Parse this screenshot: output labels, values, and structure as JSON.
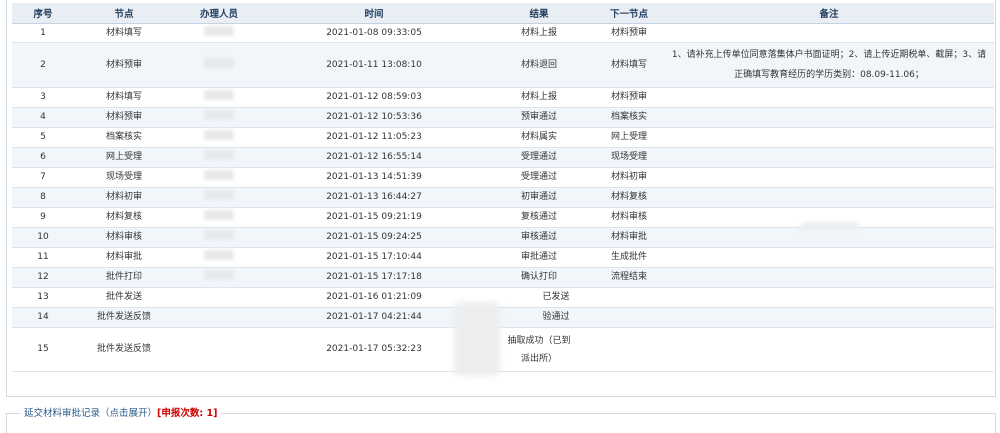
{
  "table": {
    "headers": [
      "序号",
      "节点",
      "办理人员",
      "时间",
      "结果",
      "下一节点",
      "备注"
    ],
    "rows": [
      {
        "no": "1",
        "node": "材料填写",
        "time": "2021-01-08 09:33:05",
        "result": "材料上报",
        "next": "材料预审",
        "remark": ""
      },
      {
        "no": "2",
        "node": "材料预审",
        "time": "2021-01-11 13:08:10",
        "result": "材料退回",
        "next": "材料填写",
        "remark": "1、请补充上传单位同意落集体户书面证明；2、请上传近期税单、截屏；3、请正确填写教育经历的学历类别：08.09-11.06；"
      },
      {
        "no": "3",
        "node": "材料填写",
        "time": "2021-01-12 08:59:03",
        "result": "材料上报",
        "next": "材料预审",
        "remark": ""
      },
      {
        "no": "4",
        "node": "材料预审",
        "time": "2021-01-12 10:53:36",
        "result": "预审通过",
        "next": "档案核实",
        "remark": ""
      },
      {
        "no": "5",
        "node": "档案核实",
        "time": "2021-01-12 11:05:23",
        "result": "材料属实",
        "next": "网上受理",
        "remark": ""
      },
      {
        "no": "6",
        "node": "网上受理",
        "time": "2021-01-12 16:55:14",
        "result": "受理通过",
        "next": "现场受理",
        "remark": ""
      },
      {
        "no": "7",
        "node": "现场受理",
        "time": "2021-01-13 14:51:39",
        "result": "受理通过",
        "next": "材料初审",
        "remark": ""
      },
      {
        "no": "8",
        "node": "材料初审",
        "time": "2021-01-13 16:44:27",
        "result": "初审通过",
        "next": "材料复核",
        "remark": ""
      },
      {
        "no": "9",
        "node": "材料复核",
        "time": "2021-01-15 09:21:19",
        "result": "复核通过",
        "next": "材料审核",
        "remark": ""
      },
      {
        "no": "10",
        "node": "材料审核",
        "time": "2021-01-15 09:24:25",
        "result": "审核通过",
        "next": "材料审批",
        "remark": ""
      },
      {
        "no": "11",
        "node": "材料审批",
        "time": "2021-01-15 17:10:44",
        "result": "审批通过",
        "next": "生成批件",
        "remark": ""
      },
      {
        "no": "12",
        "node": "批件打印",
        "time": "2021-01-15 17:17:18",
        "result": "确认打印",
        "next": "流程结束",
        "remark": ""
      },
      {
        "no": "13",
        "node": "批件发送",
        "time": "2021-01-16 01:21:09",
        "result": "已发送",
        "next": "",
        "remark": ""
      },
      {
        "no": "14",
        "node": "批件发送反馈",
        "time": "2021-01-17 04:21:44",
        "result": "验通过",
        "next": "",
        "remark": ""
      },
      {
        "no": "15",
        "node": "批件发送反馈",
        "time": "2021-01-17 05:32:23",
        "result": "抽取成功（已到派出所）",
        "next": "",
        "remark": ""
      }
    ]
  },
  "footer": {
    "link_label": "延交材料审批记录（点击展开）",
    "count_label": "[申报次数: 1]"
  }
}
